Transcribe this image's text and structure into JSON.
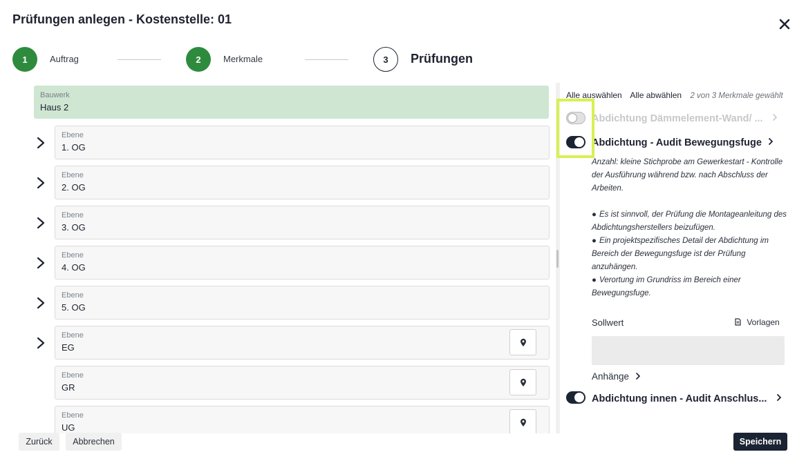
{
  "dialog": {
    "title": "Prüfungen anlegen - Kostenstelle: 01"
  },
  "stepper": {
    "steps": [
      {
        "number": "1",
        "label": "Auftrag",
        "state": "done"
      },
      {
        "number": "2",
        "label": "Merkmale",
        "state": "done"
      },
      {
        "number": "3",
        "label": "Prüfungen",
        "state": "active"
      }
    ]
  },
  "tree": {
    "bauwerk": {
      "label": "Bauwerk",
      "value": "Haus 2"
    },
    "ebenen": [
      {
        "label": "Ebene",
        "value": "1. OG"
      },
      {
        "label": "Ebene",
        "value": "2. OG"
      },
      {
        "label": "Ebene",
        "value": "3. OG"
      },
      {
        "label": "Ebene",
        "value": "4. OG"
      },
      {
        "label": "Ebene",
        "value": "5. OG"
      },
      {
        "label": "Ebene",
        "value": "EG"
      },
      {
        "label": "Ebene",
        "value": "GR"
      },
      {
        "label": "Ebene",
        "value": "UG"
      }
    ]
  },
  "merkmale": {
    "select_all": "Alle auswählen",
    "deselect_all": "Alle abwählen",
    "count": "2 von 3 Merkmale gewählt",
    "items": [
      {
        "title": "Abdichtung Dämmelement-Wand/ ...",
        "enabled": false
      },
      {
        "title": "Abdichtung - Audit Bewegungsfuge",
        "enabled": true
      },
      {
        "title": "Abdichtung innen - Audit Anschlus...",
        "enabled": true
      }
    ],
    "description": {
      "intro": "Anzahl: kleine Stichprobe am Gewerkestart - Kontrolle der Ausführung während bzw. nach Abschluss der Arbeiten.",
      "bullets": [
        "Es ist sinnvoll, der Prüfung die Montageanleitung des Abdichtungsherstellers beizufügen.",
        "Ein projektspezifisches Detail der Abdichtung im Bereich der Bewegungsfuge ist der Prüfung anzuhängen.",
        "Verortung im Grundriss im Bereich einer Bewegungsfuge."
      ]
    },
    "sollwert_label": "Sollwert",
    "vorlagen_label": "Vorlagen",
    "sollwert_value": "",
    "anhaenge_label": "Anhänge"
  },
  "footer": {
    "back": "Zurück",
    "cancel": "Abbrechen",
    "save": "Speichern"
  },
  "colors": {
    "accent_green": "#2e8b3e",
    "bauwerk_bg": "#cfe6d2",
    "dark": "#1b2433",
    "highlight": "#d9f051"
  }
}
